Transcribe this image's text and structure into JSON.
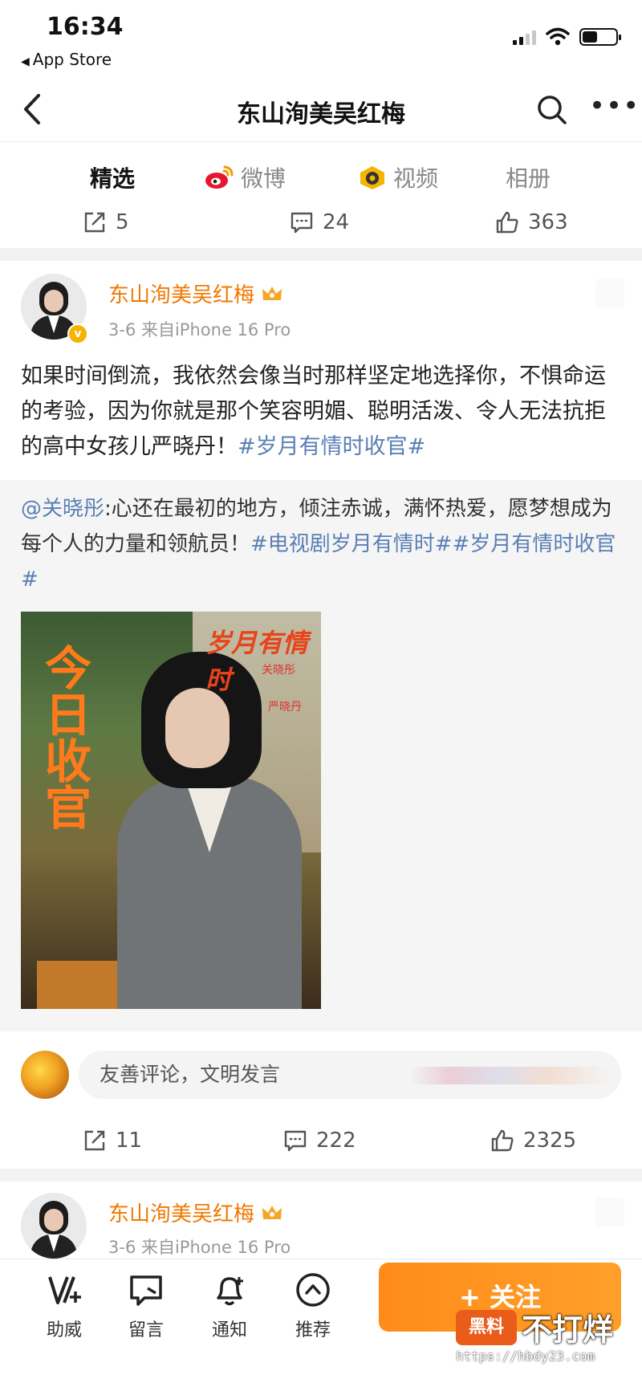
{
  "status_bar": {
    "time": "16:34",
    "back_app": "App Store"
  },
  "nav": {
    "title": "东山洵美吴红梅"
  },
  "tabs": [
    {
      "label": "精选"
    },
    {
      "label": "微博"
    },
    {
      "label": "视频"
    },
    {
      "label": "相册"
    }
  ],
  "prev_post_actions": {
    "reposts": "5",
    "comments": "24",
    "likes": "363"
  },
  "post": {
    "author": "东山洵美吴红梅",
    "meta": "3-6  来自iPhone 16 Pro",
    "text_plain": "如果时间倒流，我依然会像当时那样坚定地选择你，不惧命运的考验，因为你就是那个笑容明媚、聪明活泼、令人无法抗拒的高中女孩儿严晓丹！",
    "text_tag": "#岁月有情时收官#",
    "repost": {
      "mention": "@关晓彤",
      "text_plain": ":心还在最初的地方，倾注赤诚，满怀热爱，愿梦想成为每个人的力量和领航员！",
      "text_tags": "#电视剧岁月有情时##岁月有情时收官#",
      "poster": {
        "big_title": "今日收官",
        "logo": "岁月有情时",
        "credit_1": "关晓彤",
        "credit_2": "严晓丹"
      }
    },
    "comment_placeholder": "友善评论，文明发言",
    "actions": {
      "reposts": "11",
      "comments": "222",
      "likes": "2325"
    }
  },
  "next_post": {
    "author": "东山洵美吴红梅",
    "meta": "3-6  来自iPhone 16 Pro"
  },
  "toolbar": {
    "items": [
      {
        "label": "助威"
      },
      {
        "label": "留言"
      },
      {
        "label": "通知"
      },
      {
        "label": "推荐"
      }
    ],
    "follow": "+ 关注"
  },
  "watermark": {
    "badge": "黑料",
    "text": "不打烊",
    "url": "https://hbdy23.com"
  },
  "colors": {
    "accent": "#ff8200",
    "link": "#5a7fb5",
    "name": "#f07800"
  }
}
